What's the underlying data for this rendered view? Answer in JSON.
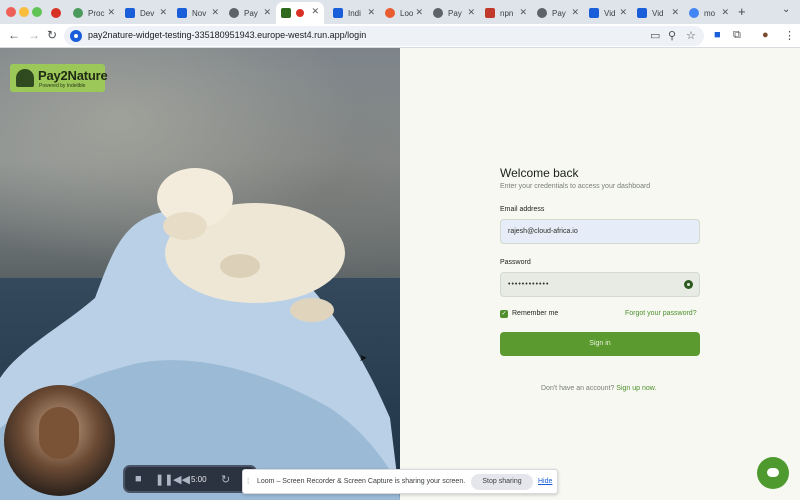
{
  "browser": {
    "tabs": [
      {
        "label": "",
        "icon": "chrome-icon",
        "color": "#d93025"
      },
      {
        "label": "Proc",
        "icon": "globe-icon",
        "color": "#4a9a5c"
      },
      {
        "label": "Dev",
        "icon": "doc-icon",
        "color": "#1a5fd9"
      },
      {
        "label": "Nov",
        "icon": "doc-icon",
        "color": "#1a5fd9"
      },
      {
        "label": "Pay",
        "icon": "globe-icon",
        "color": "#5f6368"
      },
      {
        "label": "",
        "icon": "pay2nature-icon",
        "color": "#2f6a1e",
        "active": true
      },
      {
        "label": "Indi",
        "icon": "doc-icon",
        "color": "#1a5fd9"
      },
      {
        "label": "Loo",
        "icon": "loom-icon",
        "color": "#e85c30"
      },
      {
        "label": "Pay",
        "icon": "globe-icon",
        "color": "#5f6368"
      },
      {
        "label": "npn",
        "icon": "npm-icon",
        "color": "#c0392b"
      },
      {
        "label": "Pay",
        "icon": "globe-icon",
        "color": "#5f6368"
      },
      {
        "label": "Vid",
        "icon": "doc-icon",
        "color": "#1a5fd9"
      },
      {
        "label": "Vid",
        "icon": "doc-icon",
        "color": "#1a5fd9"
      },
      {
        "label": "mo",
        "icon": "google-icon",
        "color": "#4285f4"
      }
    ],
    "url": "pay2nature-widget-testing-335180951943.europe-west4.run.app/login"
  },
  "brand": {
    "name": "Pay2Nature",
    "tagline": "Powered by Indelible"
  },
  "recorder": {
    "time": "5:00"
  },
  "login": {
    "title": "Welcome back",
    "subtitle": "Enter your credentials to access your dashboard",
    "email_label": "Email address",
    "email_value": "rajesh@cloud-africa.io",
    "password_label": "Password",
    "password_value": "••••••••••••",
    "remember_label": "Remember me",
    "remember_checked": true,
    "forgot_label": "Forgot your password?",
    "signin_label": "Sign in",
    "no_account_text": "Don't have an account? ",
    "signup_label": "Sign up now."
  },
  "loom": {
    "message": "Loom – Screen Recorder & Screen Capture is sharing your screen.",
    "stop_label": "Stop sharing",
    "hide_label": "Hide"
  },
  "colors": {
    "accent": "#5a9a2e",
    "panel_bg": "#f6f8f1"
  }
}
